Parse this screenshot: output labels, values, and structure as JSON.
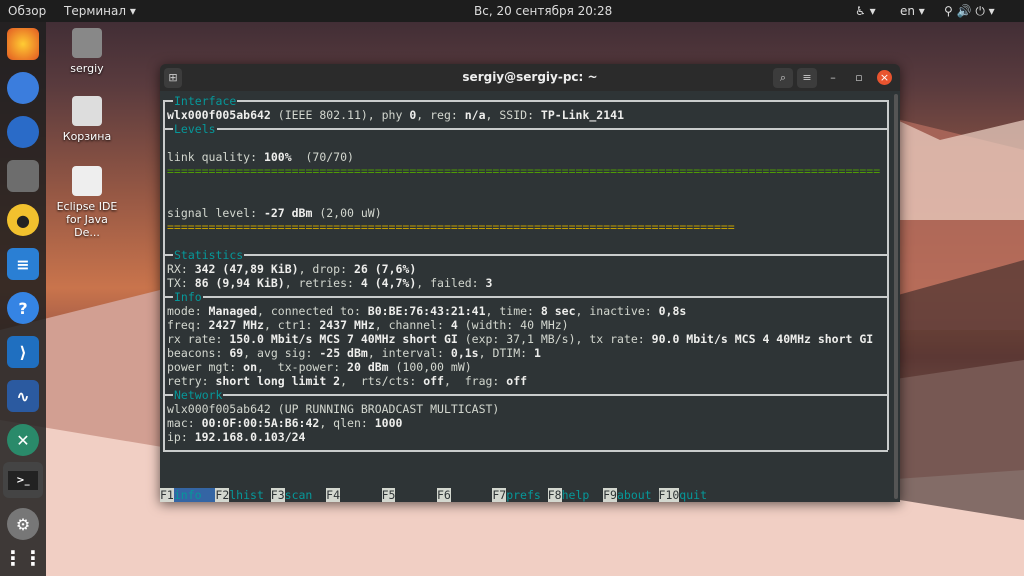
{
  "topbar": {
    "activities": "Обзор",
    "app_menu": "Терминал ▾",
    "clock": "Вс, 20 сентября  20:28",
    "accessibility": "♿ ▾",
    "lang": "en ▾",
    "system": "⚲ 🔊 ⏻ ▾"
  },
  "desktop": {
    "icons": [
      {
        "label": "sergiy"
      },
      {
        "label": "Корзина"
      },
      {
        "label": "Eclipse IDE for Java De..."
      }
    ]
  },
  "dock": [
    "firefox",
    "chromium",
    "thunderbird",
    "files",
    "rhythmbox",
    "libreoffice-writer",
    "help",
    "vscode",
    "system-monitor",
    "crossover",
    "terminal",
    "settings",
    "show-apps"
  ],
  "window": {
    "title": "sergiy@sergiy-pc: ~"
  },
  "sections": {
    "interface": "Interface",
    "levels": "Levels",
    "statistics": "Statistics",
    "info": "Info",
    "network": "Network"
  },
  "levels": {
    "link_fraction": 1.0,
    "link_color": "#4e9a06",
    "signal_fraction": 0.8,
    "signal_color": "#c4a000"
  },
  "lines": {
    "iface": [
      [
        "wlx000f005ab642",
        1
      ],
      [
        " (IEEE 802.11), phy ",
        0
      ],
      [
        "0",
        1
      ],
      [
        ", reg: ",
        0
      ],
      [
        "n/a",
        1
      ],
      [
        ", SSID: ",
        0
      ],
      [
        "TP-Link_2141",
        1
      ]
    ],
    "link": [
      [
        "link quality: ",
        0
      ],
      [
        "100%",
        1
      ],
      [
        "  (70/70)",
        0
      ]
    ],
    "signal": [
      [
        "signal level: ",
        0
      ],
      [
        "-27 dBm",
        1
      ],
      [
        " (2,00 uW)",
        0
      ]
    ],
    "rx": [
      [
        "RX: ",
        0
      ],
      [
        "342 (47,89 KiB)",
        1
      ],
      [
        ", drop: ",
        0
      ],
      [
        "26 (7,6%)",
        1
      ]
    ],
    "tx": [
      [
        "TX: ",
        0
      ],
      [
        "86 (9,94 KiB)",
        1
      ],
      [
        ", retries: ",
        0
      ],
      [
        "4 (4,7%)",
        1
      ],
      [
        ", failed: ",
        0
      ],
      [
        "3",
        1
      ]
    ],
    "mode": [
      [
        "mode: ",
        0
      ],
      [
        "Managed",
        1
      ],
      [
        ", connected to: ",
        0
      ],
      [
        "B0:BE:76:43:21:41",
        1
      ],
      [
        ", time: ",
        0
      ],
      [
        "8 sec",
        1
      ],
      [
        ", inactive: ",
        0
      ],
      [
        "0,8s",
        1
      ]
    ],
    "freq": [
      [
        "freq: ",
        0
      ],
      [
        "2427 MHz",
        1
      ],
      [
        ", ctr1: ",
        0
      ],
      [
        "2437 MHz",
        1
      ],
      [
        ", channel: ",
        0
      ],
      [
        "4",
        1
      ],
      [
        " (width: 40 MHz)",
        0
      ]
    ],
    "rate": [
      [
        "rx rate: ",
        0
      ],
      [
        "150.0 Mbit/s MCS 7 40MHz short GI",
        1
      ],
      [
        " (exp: 37,1 MB/s), tx rate: ",
        0
      ],
      [
        "90.0 Mbit/s MCS 4 40MHz short GI",
        1
      ]
    ],
    "beacons": [
      [
        "beacons: ",
        0
      ],
      [
        "69",
        1
      ],
      [
        ", avg sig: ",
        0
      ],
      [
        "-25 dBm",
        1
      ],
      [
        ", interval: ",
        0
      ],
      [
        "0,1s",
        1
      ],
      [
        ", DTIM: ",
        0
      ],
      [
        "1",
        1
      ]
    ],
    "power": [
      [
        "power mgt: ",
        0
      ],
      [
        "on",
        1
      ],
      [
        ",  tx-power: ",
        0
      ],
      [
        "20 dBm",
        1
      ],
      [
        " (100,00 mW)",
        0
      ]
    ],
    "retry": [
      [
        "retry: ",
        0
      ],
      [
        "short long limit 2",
        1
      ],
      [
        ",  rts/cts: ",
        0
      ],
      [
        "off",
        1
      ],
      [
        ",  frag: ",
        0
      ],
      [
        "off",
        1
      ]
    ],
    "net": [
      [
        "wlx000f005ab642",
        0
      ],
      [
        " (UP RUNNING BROADCAST MULTICAST)",
        0
      ]
    ],
    "mac": [
      [
        "mac: ",
        0
      ],
      [
        "00:0F:00:5A:B6:42",
        1
      ],
      [
        ", qlen: ",
        0
      ],
      [
        "1000",
        1
      ]
    ],
    "ip": [
      [
        "ip: ",
        0
      ],
      [
        "192.168.0.103/24",
        1
      ]
    ]
  },
  "fkeys": [
    {
      "key": "F1",
      "label": "info",
      "active": true
    },
    {
      "key": "F2",
      "label": "lhist"
    },
    {
      "key": "F3",
      "label": "scan"
    },
    {
      "key": "F4",
      "label": ""
    },
    {
      "key": "F5",
      "label": ""
    },
    {
      "key": "F6",
      "label": ""
    },
    {
      "key": "F7",
      "label": "prefs"
    },
    {
      "key": "F8",
      "label": "help"
    },
    {
      "key": "F9",
      "label": "about"
    },
    {
      "key": "F10",
      "label": "quit"
    }
  ]
}
